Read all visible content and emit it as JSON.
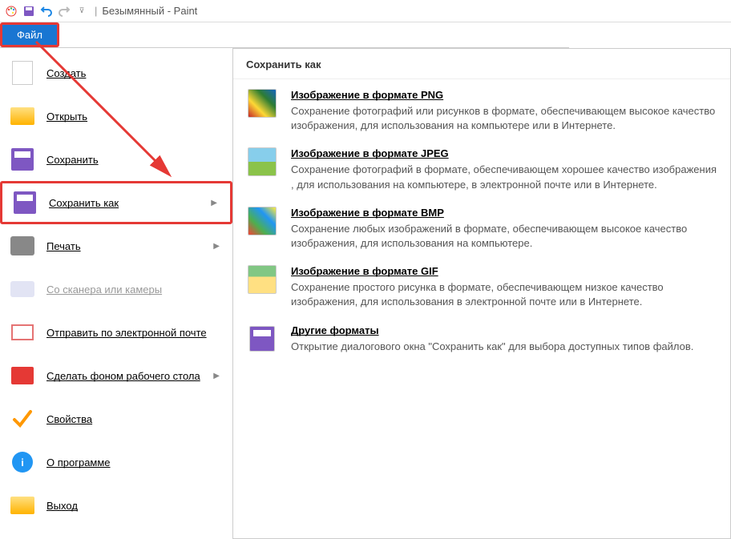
{
  "title": "Безымянный - Paint",
  "file_tab": "Файл",
  "left_menu": {
    "create": "Создать",
    "open": "Открыть",
    "save": "Сохранить",
    "save_as": "Сохранить как",
    "print": "Печать",
    "scanner": "Со сканера или камеры",
    "email": "Отправить по электронной почте",
    "desktop": "Сделать фоном рабочего стола",
    "properties": "Свойства",
    "about": "О программе",
    "exit": "Выход"
  },
  "right_panel": {
    "header": "Сохранить как",
    "options": {
      "png": {
        "title": "Изображение в формате PNG",
        "desc": "Сохранение фотографий или рисунков в формате, обеспечивающем высокое качество изображения, для использования на компьютере или в Интернете."
      },
      "jpeg": {
        "title": "Изображение в формате JPEG",
        "desc": "Сохранение фотографий в формате, обеспечивающем хорошее качество изображения , для использования на компьютере, в электронной почте или в Интернете."
      },
      "bmp": {
        "title": "Изображение в формате BMP",
        "desc": "Сохранение любых изображений в формате, обеспечивающем высокое качество изображения, для использования на компьютере."
      },
      "gif": {
        "title": "Изображение в формате GIF",
        "desc": "Сохранение простого рисунка в формате, обеспечивающем низкое качество изображения, для использования в электронной почте или в Интернете."
      },
      "other": {
        "title": "Другие форматы",
        "desc": "Открытие диалогового окна \"Сохранить как\" для выбора доступных типов файлов."
      }
    }
  }
}
